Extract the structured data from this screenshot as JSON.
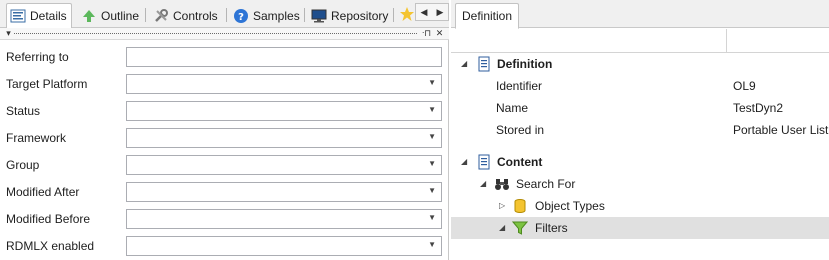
{
  "left_tabs": [
    {
      "label": "Details",
      "icon": "details-icon"
    },
    {
      "label": "Outline",
      "icon": "outline-icon"
    },
    {
      "label": "Controls",
      "icon": "controls-icon"
    },
    {
      "label": "Samples",
      "icon": "help-icon"
    },
    {
      "label": "Repository",
      "icon": "monitor-icon"
    }
  ],
  "form": {
    "fields": [
      {
        "label": "Referring to",
        "value": "",
        "type": "text"
      },
      {
        "label": "Target Platform",
        "value": "",
        "type": "dropdown"
      },
      {
        "label": "Status",
        "value": "",
        "type": "dropdown"
      },
      {
        "label": "Framework",
        "value": "",
        "type": "dropdown"
      },
      {
        "label": "Group",
        "value": "",
        "type": "dropdown"
      },
      {
        "label": "Modified After",
        "value": "",
        "type": "dropdown"
      },
      {
        "label": "Modified Before",
        "value": "",
        "type": "dropdown"
      },
      {
        "label": "RDMLX enabled",
        "value": "",
        "type": "dropdown"
      }
    ]
  },
  "right_tab": {
    "label": "Definition"
  },
  "tree": {
    "definition": {
      "label": "Definition",
      "props": [
        {
          "name": "Identifier",
          "value": "OL9"
        },
        {
          "name": "Name",
          "value": "TestDyn2"
        },
        {
          "name": "Stored in",
          "value": "Portable User List"
        }
      ]
    },
    "content": {
      "label": "Content",
      "search_for": "Search For",
      "object_types": "Object Types",
      "filters": "Filters"
    }
  },
  "colors": {
    "selected_row": "#e0e0e0",
    "accent_yellow": "#f4c430",
    "filter_green": "#7cc242"
  }
}
